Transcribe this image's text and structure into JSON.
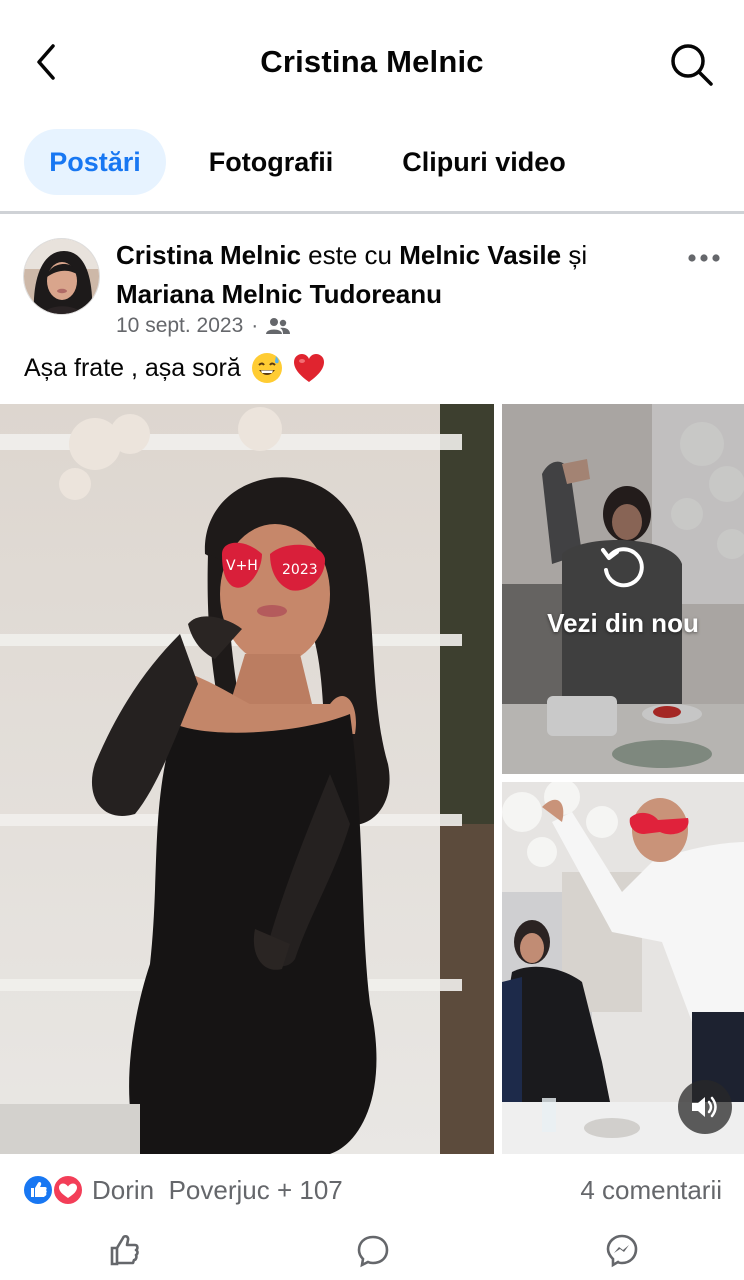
{
  "header": {
    "title": "Cristina Melnic",
    "back_icon": "chevron-left-icon",
    "search_icon": "search-icon"
  },
  "tabs": [
    {
      "label": "Postări",
      "active": true
    },
    {
      "label": "Fotografii",
      "active": false
    },
    {
      "label": "Clipuri video",
      "active": false
    }
  ],
  "post": {
    "author": "Cristina Melnic",
    "connector_1": " este cu ",
    "tagged_1": "Melnic Vasile",
    "connector_2": " și ",
    "tagged_2": "Mariana Melnic Tudoreanu",
    "date": "10 sept. 2023",
    "separator": "·",
    "audience_icon": "friends-icon",
    "caption": "Așa frate , așa soră",
    "caption_emoji_1": "😅",
    "caption_emoji_2": "❤️",
    "more_icon": "more-horizontal-icon"
  },
  "media": {
    "replay_label": "Vezi din nou",
    "replay_icon": "replay-icon",
    "sound_icon": "speaker-icon"
  },
  "reactions": {
    "names": "Dorin  Poverjuc + 107",
    "comments": "4 comentarii",
    "icons": [
      "like-icon",
      "love-icon"
    ]
  },
  "colors": {
    "accent": "#1877f2",
    "active_tab_bg": "#e7f3ff",
    "secondary_text": "#65676b",
    "like_blue": "#1877f2",
    "love_red": "#f33e58"
  }
}
